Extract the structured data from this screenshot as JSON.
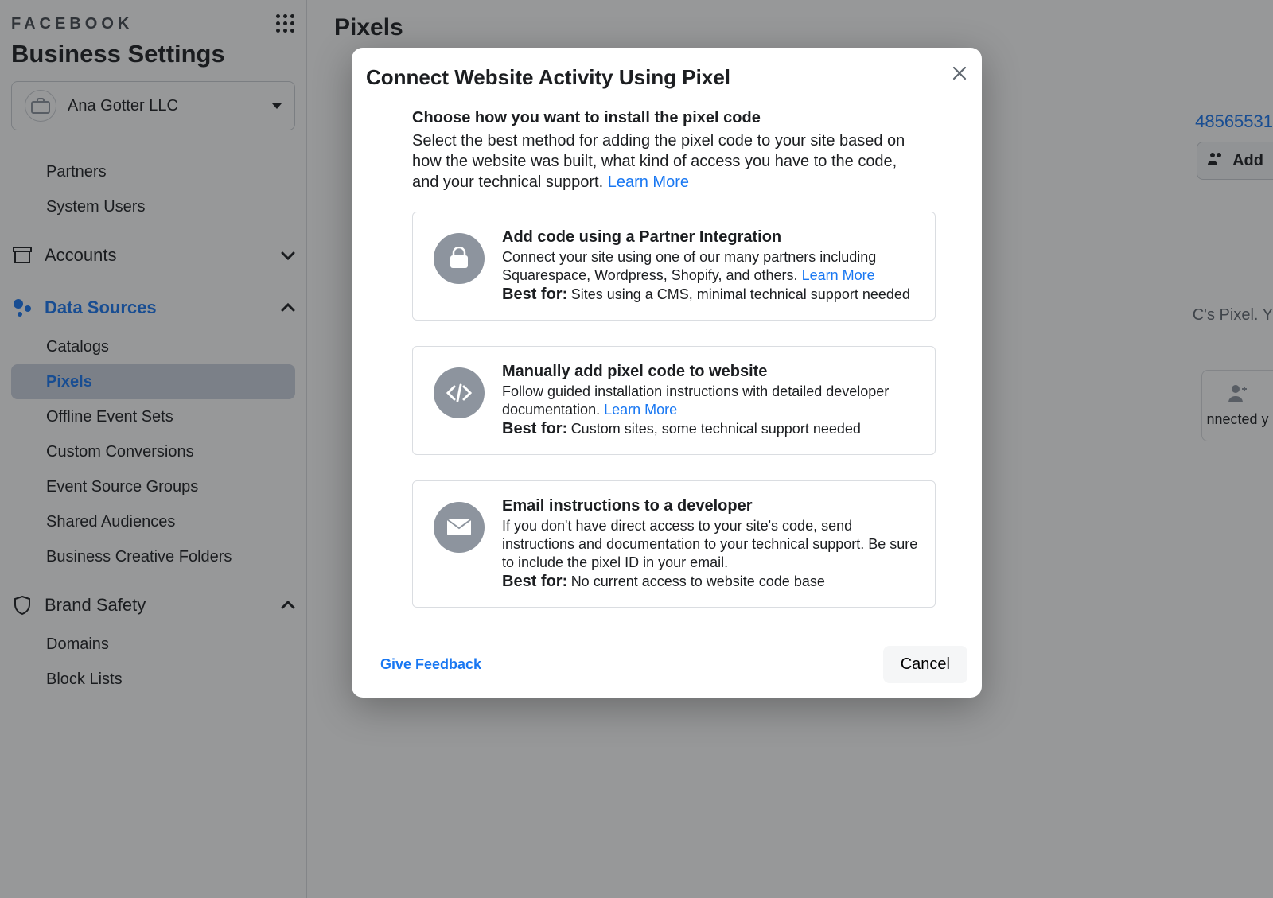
{
  "header": {
    "brand": "FACEBOOK",
    "page_title": "Business Settings"
  },
  "account": {
    "name": "Ana Gotter LLC"
  },
  "sidebar": {
    "top_items": [
      "Partners",
      "System Users"
    ],
    "sections": [
      {
        "label": "Accounts",
        "icon": "archive-box-icon",
        "expanded": false,
        "items": []
      },
      {
        "label": "Data Sources",
        "icon": "nodes-icon",
        "expanded": true,
        "active": true,
        "items": [
          "Catalogs",
          "Pixels",
          "Offline Event Sets",
          "Custom Conversions",
          "Event Source Groups",
          "Shared Audiences",
          "Business Creative Folders"
        ],
        "active_item": "Pixels"
      },
      {
        "label": "Brand Safety",
        "icon": "shield-icon",
        "expanded": true,
        "items": [
          "Domains",
          "Block Lists"
        ]
      }
    ]
  },
  "main": {
    "title": "Pixels",
    "pixel_id_fragment": "48565531",
    "add_button_fragment": "Add",
    "bg_text_fragment": "C's Pixel. Y",
    "connected_fragment": "nnected y"
  },
  "modal": {
    "title": "Connect Website Activity Using Pixel",
    "intro_heading": "Choose how you want to install the pixel code",
    "intro_body": "Select the best method for adding the pixel code to your site based on how the website was built, what kind of access you have to the code, and your technical support.",
    "learn_more": "Learn More",
    "options": [
      {
        "icon": "bag-icon",
        "title": "Add code using a Partner Integration",
        "desc": "Connect your site using one of our many partners including Squarespace, Wordpress, Shopify, and others.",
        "link": "Learn More",
        "best_for_label": "Best for:",
        "best_for": "Sites using a CMS, minimal technical support needed"
      },
      {
        "icon": "code-icon",
        "title": "Manually add pixel code to website",
        "desc": "Follow guided installation instructions with detailed developer documentation.",
        "link": "Learn More",
        "best_for_label": "Best for:",
        "best_for": "Custom sites, some technical support needed"
      },
      {
        "icon": "envelope-icon",
        "title": "Email instructions to a developer",
        "desc": "If you don't have direct access to your site's code, send instructions and documentation to your technical support. Be sure to include the pixel ID in your email.",
        "link": "",
        "best_for_label": "Best for:",
        "best_for": "No current access to website code base"
      }
    ],
    "feedback": "Give Feedback",
    "cancel": "Cancel"
  }
}
